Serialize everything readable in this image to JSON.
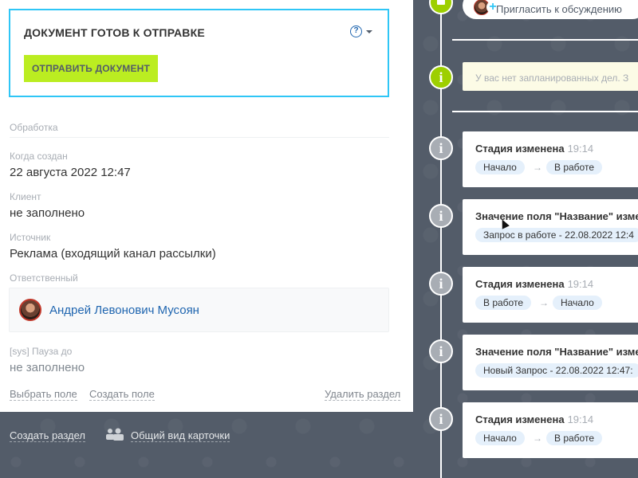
{
  "document": {
    "title": "ДОКУМЕНТ ГОТОВ К ОТПРАВКЕ",
    "help_glyph": "?",
    "send_button": "ОТПРАВИТЬ ДОКУМЕНТ"
  },
  "section": {
    "name": "Обработка",
    "fields": [
      {
        "label": "Когда создан",
        "value": "22 августа 2022 12:47"
      },
      {
        "label": "Клиент",
        "value": "не заполнено"
      },
      {
        "label": "Источник",
        "value": "Реклама (входящий канал рассылки)"
      },
      {
        "label": "Ответственный",
        "value": "Андрей Левонович Мусоян"
      },
      {
        "label": "[sys] Пауза до",
        "value": "не заполнено"
      }
    ],
    "actions": {
      "select_field": "Выбрать поле",
      "create_field": "Создать поле",
      "delete_section": "Удалить раздел"
    }
  },
  "bottom": {
    "create_section": "Создать раздел",
    "common_view": "Общий вид карточки"
  },
  "timeline": {
    "invite_text": "Пригласить к обсуждению",
    "todo_text": "У вас нет запланированных дел. З",
    "events": [
      {
        "title": "Стадия изменена",
        "time": "19:14",
        "from": "Начало",
        "to": "В работе"
      },
      {
        "title": "Значение поля \"Название\" изме",
        "time": "",
        "value": "Запрос в работе - 22.08.2022 12:4"
      },
      {
        "title": "Стадия изменена",
        "time": "19:14",
        "from": "В работе",
        "to": "Начало"
      },
      {
        "title": "Значение поля \"Название\" изме",
        "time": "",
        "value": "Новый Запрос - 22.08.2022 12:47:"
      },
      {
        "title": "Стадия изменена",
        "time": "19:14",
        "from": "Начало",
        "to": "В работе"
      }
    ],
    "arrow_glyph": "→",
    "info_glyph": "i"
  },
  "colors": {
    "accent_blue": "#2fc6f6",
    "send_green": "#bbed21",
    "timeline_green": "#9dcf00",
    "link_blue": "#2066b0",
    "dark_bg": "#535c69"
  }
}
